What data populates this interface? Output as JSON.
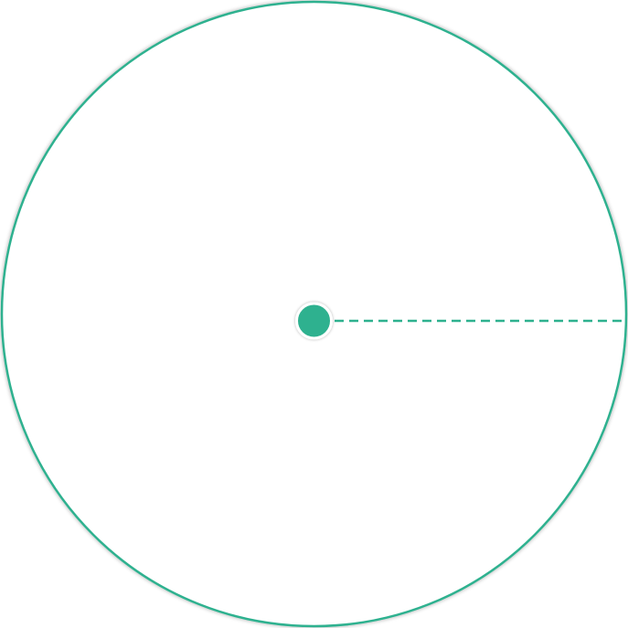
{
  "map": {
    "radius_circle": {
      "stroke_color": "#2eb18f",
      "fill_color": "#ffffff",
      "shadow_color": "#00000033"
    },
    "center_marker": {
      "fill_color": "#2eb18f",
      "border_color": "#ffffff",
      "icon": "location-dot-icon"
    },
    "radius_line": {
      "color": "#2eb18f",
      "style": "dashed"
    }
  }
}
